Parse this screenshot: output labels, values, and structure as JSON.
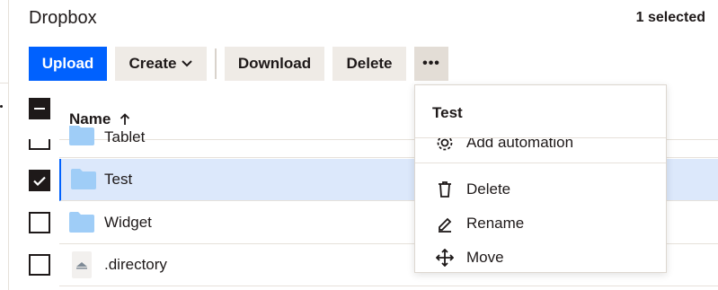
{
  "header": {
    "title": "Dropbox",
    "selected_count": "1 selected"
  },
  "toolbar": {
    "upload": "Upload",
    "create": "Create",
    "download": "Download",
    "delete": "Delete",
    "more": "•••"
  },
  "table": {
    "column_name": "Name",
    "rows": [
      {
        "name": "Tablet",
        "type": "folder",
        "checked": false
      },
      {
        "name": "Test",
        "type": "folder",
        "checked": true
      },
      {
        "name": "Widget",
        "type": "folder",
        "checked": false
      },
      {
        "name": ".directory",
        "type": "file",
        "checked": false
      }
    ]
  },
  "context_menu": {
    "title": "Test",
    "items": [
      {
        "label": "Add automation",
        "icon": "gear-icon"
      },
      {
        "label": "Delete",
        "icon": "trash-icon"
      },
      {
        "label": "Rename",
        "icon": "pencil-icon"
      },
      {
        "label": "Move",
        "icon": "move-arrows-icon"
      }
    ]
  },
  "colors": {
    "accent": "#0061fe",
    "selected_row": "#dce8fb",
    "button_bg": "#efebe6",
    "folder": "#9fcdf7"
  }
}
